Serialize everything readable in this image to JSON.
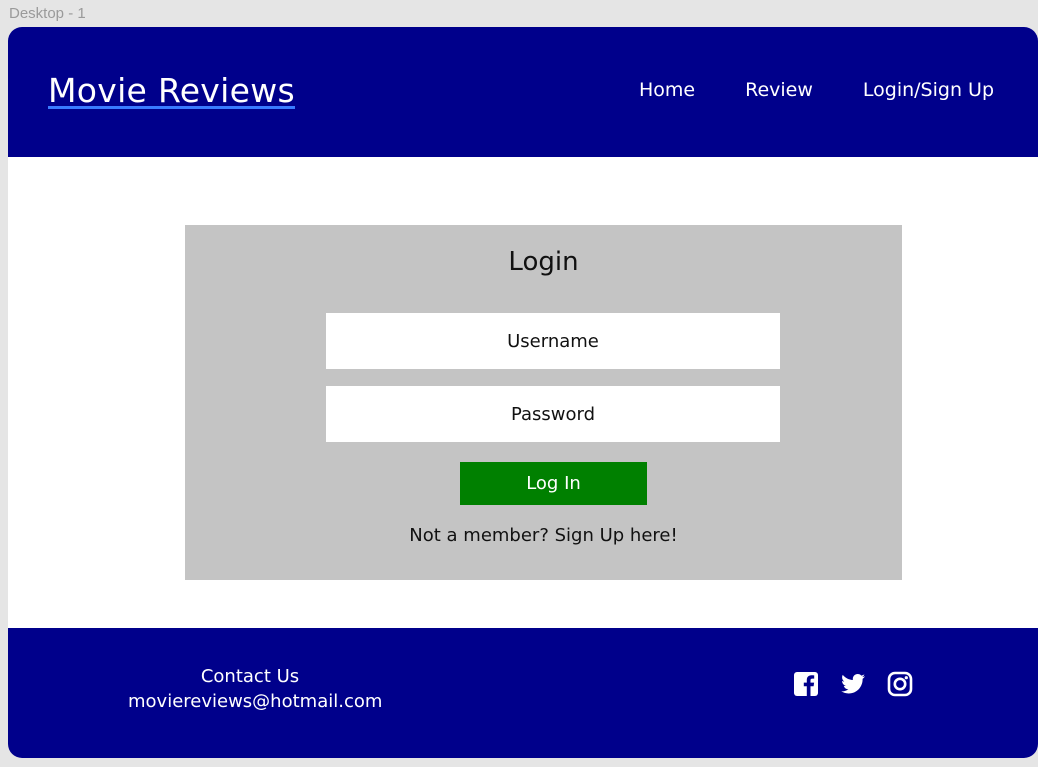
{
  "canvas": {
    "frame_label": "Desktop - 1"
  },
  "header": {
    "brand": "Movie Reviews",
    "nav": [
      {
        "label": "Home"
      },
      {
        "label": "Review"
      },
      {
        "label": "Login/Sign Up"
      }
    ]
  },
  "login": {
    "title": "Login",
    "username_placeholder": "Username",
    "password_placeholder": "Password",
    "submit_label": "Log In",
    "signup_text": "Not a member? Sign Up here!"
  },
  "footer": {
    "contact_label": "Contact Us",
    "email": "moviereviews@hotmail.com",
    "social_icons": [
      "facebook-icon",
      "twitter-icon",
      "instagram-icon"
    ]
  },
  "colors": {
    "header_bg": "#00008b",
    "footer_bg": "#00008b",
    "login_panel_bg": "#c4c4c4",
    "login_button_bg": "#008000",
    "brand_underline": "#3a7bff"
  }
}
